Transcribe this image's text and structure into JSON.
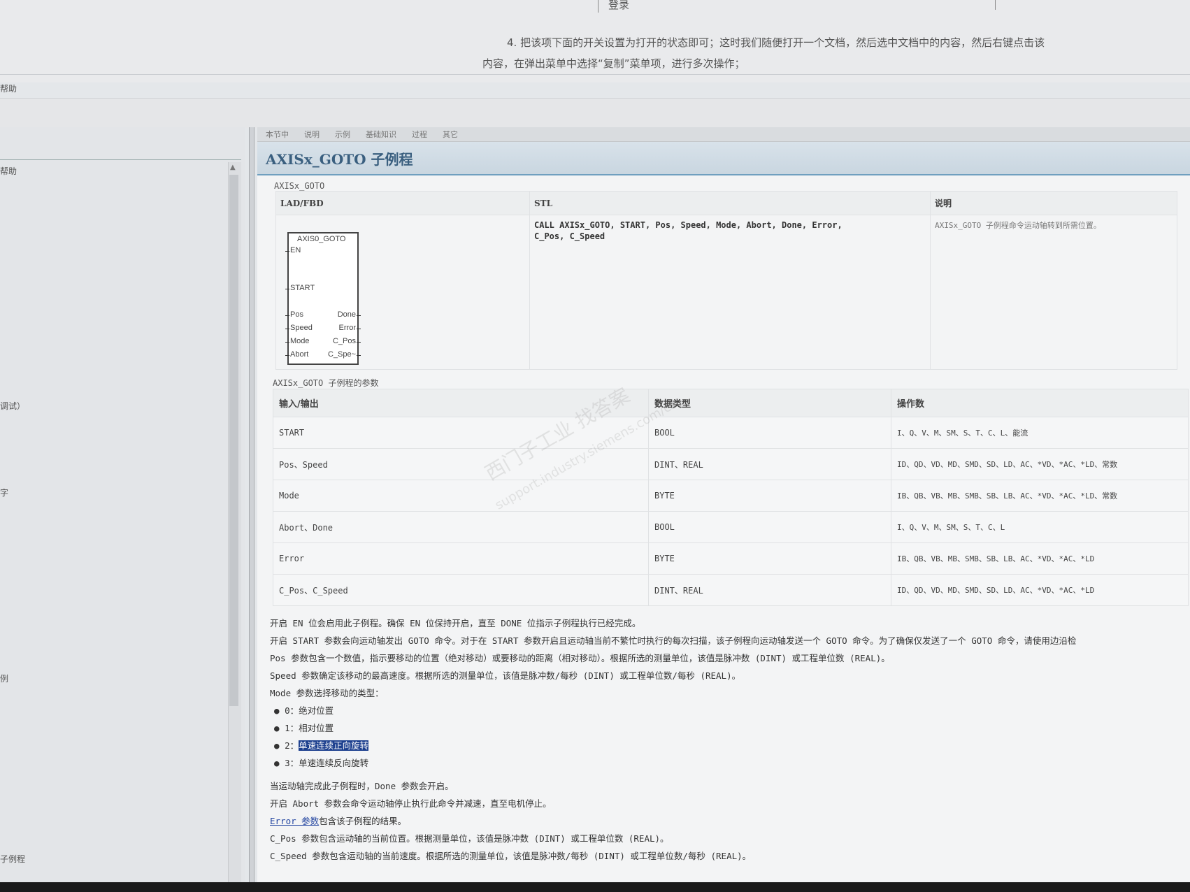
{
  "top": {
    "login_label": "登录",
    "instruction_line1": "4. 把该项下面的开关设置为打开的状态即可；这时我们随便打开一个文档，然后选中文档中的内容，然后右键点击该",
    "instruction_line2": "内容，在弹出菜单中选择“复制”菜单项，进行多次操作；"
  },
  "menu_fragment": "帮助",
  "left_fragments": [
    "帮助",
    "调试）",
    "字",
    "例",
    "子例程"
  ],
  "tabs": [
    "本节中",
    "说明",
    "示例",
    "基础知识",
    "过程",
    "其它"
  ],
  "title": "AXISx_GOTO 子例程",
  "table1": {
    "caption": "AXISx_GOTO",
    "headers": [
      "LAD/FBD",
      "STL",
      "说明"
    ],
    "stl_line1": "CALL AXISx_GOTO, START, Pos, Speed, Mode, Abort, Done, Error,",
    "stl_line2": "C_Pos, C_Speed",
    "description": "AXISx_GOTO 子例程命令运动轴转到所需位置。",
    "fb_block": {
      "name": "AXIS0_GOTO",
      "inputs": [
        "EN",
        "START",
        "Pos",
        "Speed",
        "Mode",
        "Abort"
      ],
      "outputs": [
        "Done",
        "Error",
        "C_Pos",
        "C_Spe~"
      ]
    }
  },
  "table2": {
    "caption": "AXISx_GOTO 子例程的参数",
    "headers": [
      "输入/输出",
      "数据类型",
      "操作数"
    ],
    "rows": [
      {
        "io": "START",
        "type": "BOOL",
        "operands": "I、Q、V、M、SM、S、T、C、L、能流"
      },
      {
        "io": "Pos、Speed",
        "type": "DINT、REAL",
        "operands": "ID、QD、VD、MD、SMD、SD、LD、AC、*VD、*AC、*LD、常数"
      },
      {
        "io": "Mode",
        "type": "BYTE",
        "operands": "IB、QB、VB、MB、SMB、SB、LB、AC、*VD、*AC、*LD、常数"
      },
      {
        "io": "Abort、Done",
        "type": "BOOL",
        "operands": "I、Q、V、M、SM、S、T、C、L"
      },
      {
        "io": "Error",
        "type": "BYTE",
        "operands": "IB、QB、VB、MB、SMB、SB、LB、AC、*VD、*AC、*LD"
      },
      {
        "io": "C_Pos、C_Speed",
        "type": "DINT、REAL",
        "operands": "ID、QD、VD、MD、SMD、SD、LD、AC、*VD、*AC、*LD"
      }
    ]
  },
  "body": {
    "p1": "开启 EN 位会启用此子例程。确保 EN 位保持开启，直至 DONE 位指示子例程执行已经完成。",
    "p2": "开启 START 参数会向运动轴发出 GOTO 命令。对于在 START 参数开启且运动轴当前不繁忙时执行的每次扫描，该子例程向运动轴发送一个 GOTO 命令。为了确保仅发送了一个 GOTO 命令，请使用边沿检",
    "p3": "Pos 参数包含一个数值，指示要移动的位置（绝对移动）或要移动的距离（相对移动）。根据所选的测量单位，该值是脉冲数 (DINT) 或工程单位数 (REAL)。",
    "p4": "Speed 参数确定该移动的最高速度。根据所选的测量单位，该值是脉冲数/每秒 (DINT) 或工程单位数/每秒 (REAL)。",
    "p5": "Mode 参数选择移动的类型：",
    "bullets": [
      "0：绝对位置",
      "1：相对位置",
      "2：",
      "3：单速连续反向旋转"
    ],
    "highlighted": "单速连续正向旋转",
    "p6": "当运动轴完成此子例程时，Done 参数会开启。",
    "p7": "开启 Abort 参数会命令运动轴停止执行此命令并减速，直至电机停止。",
    "p8_link": "Error 参数",
    "p8_rest": "包含该子例程的结果。",
    "p9": "C_Pos 参数包含运动轴的当前位置。根据测量单位，该值是脉冲数 (DINT) 或工程单位数 (REAL)。",
    "p10": "C_Speed 参数包含运动轴的当前速度。根据所选的测量单位，该值是脉冲数/每秒 (DINT) 或工程单位数/每秒 (REAL)。"
  },
  "watermark": {
    "line1": "西门子工业   找答案",
    "line2": "support.industry.siemens.com/cs"
  }
}
